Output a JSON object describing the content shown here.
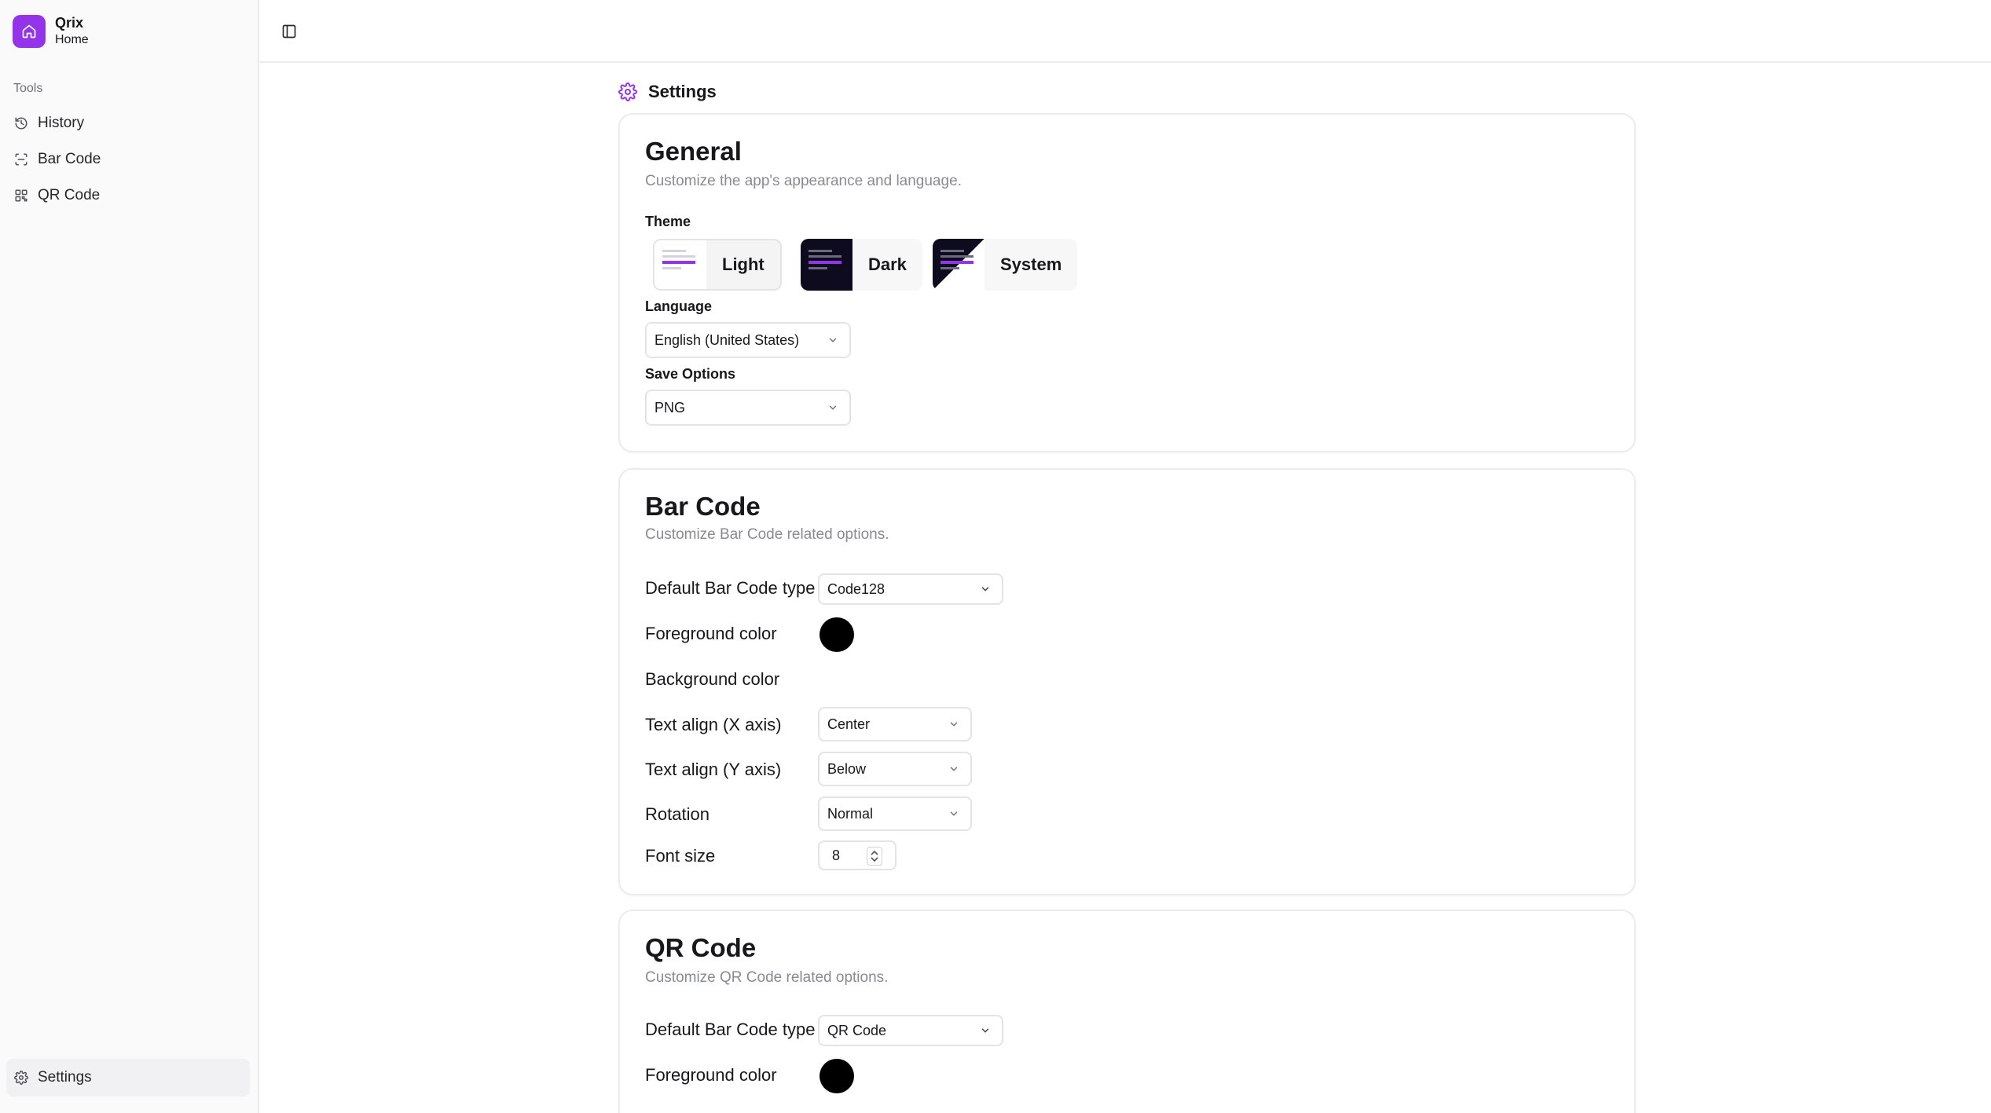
{
  "sidebar": {
    "brand_name": "Qrix",
    "brand_sub": "Home",
    "group_label": "Tools",
    "items": [
      {
        "label": "History",
        "icon": "history-icon"
      },
      {
        "label": "Bar Code",
        "icon": "barcode-scan-icon"
      },
      {
        "label": "QR Code",
        "icon": "qr-code-icon"
      }
    ],
    "settings_label": "Settings"
  },
  "page": {
    "title": "Settings"
  },
  "general": {
    "title": "General",
    "description": "Customize the app's appearance and language.",
    "theme_label": "Theme",
    "themes": [
      {
        "label": "Light",
        "selected": true
      },
      {
        "label": "Dark",
        "selected": false
      },
      {
        "label": "System",
        "selected": false
      }
    ],
    "language_label": "Language",
    "language_value": "English (United States)",
    "save_label": "Save Options",
    "save_value": "PNG"
  },
  "barcode": {
    "title": "Bar Code",
    "description": "Customize Bar Code related options.",
    "type_label": "Default Bar Code type",
    "type_value": "Code128",
    "fg_label": "Foreground color",
    "fg_color": "#000000",
    "bg_label": "Background color",
    "text_x_label": "Text align (X axis)",
    "text_x_value": "Center",
    "text_y_label": "Text align (Y axis)",
    "text_y_value": "Below",
    "rotation_label": "Rotation",
    "rotation_value": "Normal",
    "font_size_label": "Font size",
    "font_size_value": "8"
  },
  "qrcode": {
    "title": "QR Code",
    "description": "Customize QR Code related options.",
    "type_label": "Default Bar Code type",
    "type_value": "QR Code",
    "fg_label": "Foreground color",
    "fg_color": "#000000"
  },
  "colors": {
    "accent": "#9333ea",
    "border": "#ececee",
    "muted_text": "#8a8a92"
  }
}
